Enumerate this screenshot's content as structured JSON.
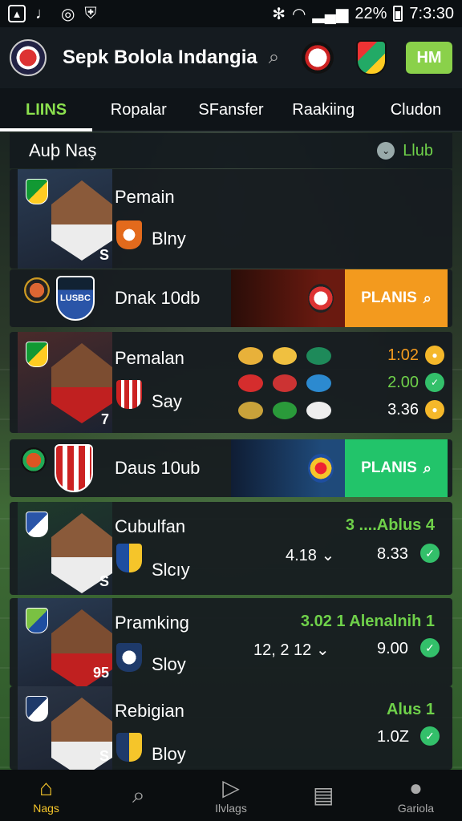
{
  "status_bar": {
    "battery": "22%",
    "time": "7:3:30"
  },
  "app": {
    "title": "Sepk Bolola Indangia",
    "hm_label": "HM"
  },
  "tabs": [
    {
      "label": "LIINS",
      "active": true
    },
    {
      "label": "Ropalar"
    },
    {
      "label": "SFansfer"
    },
    {
      "label": "Raakiing"
    },
    {
      "label": "Cludon"
    }
  ],
  "section": {
    "title": "Auþ Naş",
    "filter": "Llub"
  },
  "cards": {
    "p1": {
      "name": "Pemain",
      "club": "Blny",
      "num": "S"
    },
    "promo1": {
      "title": "Dnak 10db",
      "crest_text": "LUSBC",
      "button": "PLANIS"
    },
    "p2": {
      "name": "Pemalan",
      "club": "Say",
      "num": "7",
      "odds": [
        "1:02",
        "2.00",
        "3.36"
      ]
    },
    "promo2": {
      "title": "Daus 10ub",
      "button": "PLANIS"
    },
    "p3": {
      "name": "Cubulfan",
      "club": "Slcıy",
      "num": "S",
      "score": "3 ....Ablus 4",
      "val_left": "4.18",
      "val_right": "8.33"
    },
    "p4": {
      "name": "Pramking",
      "club": "Sloy",
      "num": "95",
      "score": "3.02 1 Alenalnih 1",
      "val_left": "12, 2 12",
      "val_right": "9.00"
    },
    "p5": {
      "name": "Rebigian",
      "club": "Bloy",
      "num": "S",
      "score": "Alus 1",
      "val_right": "1.0Z"
    }
  },
  "bottom_nav": [
    {
      "label": "Nags",
      "icon": "home-icon",
      "active": true
    },
    {
      "label": "",
      "icon": "search-icon"
    },
    {
      "label": "Ilvlags",
      "icon": "play-icon"
    },
    {
      "label": "",
      "icon": "clipboard-icon"
    },
    {
      "label": "Gariola",
      "icon": "profile-icon"
    }
  ],
  "colors": {
    "accent_green": "#6fd14a",
    "orange": "#f39a1e",
    "green_btn": "#22c46a",
    "nav_active": "#f5c52a"
  }
}
